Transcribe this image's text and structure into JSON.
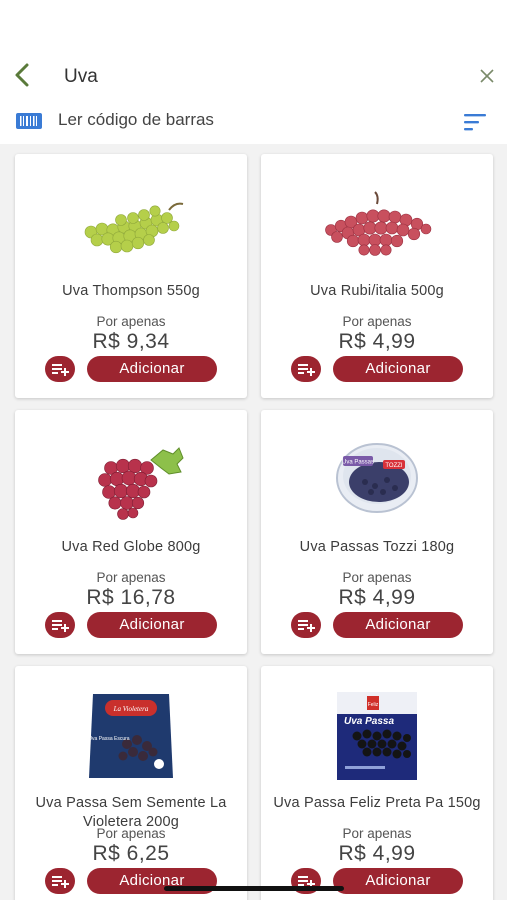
{
  "header": {
    "search_query": "Uva",
    "barcode_label": "Ler código de barras"
  },
  "products": [
    {
      "name": "Uva Thompson 550g",
      "price_prefix": "Por apenas",
      "price": "R$ 9,34",
      "add_label": "Adicionar"
    },
    {
      "name": "Uva Rubi/italia 500g",
      "price_prefix": "Por apenas",
      "price": "R$ 4,99",
      "add_label": "Adicionar"
    },
    {
      "name": "Uva Red Globe 800g",
      "price_prefix": "Por apenas",
      "price": "R$ 16,78",
      "add_label": "Adicionar"
    },
    {
      "name": "Uva Passas Tozzi 180g",
      "price_prefix": "Por apenas",
      "price": "R$ 4,99",
      "add_label": "Adicionar"
    },
    {
      "name": "Uva Passa Sem Semente La Violetera 200g",
      "price_prefix": "Por apenas",
      "price": "R$ 6,25",
      "add_label": "Adicionar"
    },
    {
      "name": "Uva Passa Feliz Preta Pa 150g",
      "price_prefix": "Por apenas",
      "price": "R$ 4,99",
      "add_label": "Adicionar"
    }
  ],
  "package_labels": {
    "tozzi": "Uva Passas",
    "tozzi_brand": "TOZZI",
    "violetera": "La Violetera",
    "violetera_sub": "Uva Passa Escura",
    "feliz": "Uva Passa",
    "feliz_brand": "Feliz"
  },
  "colors": {
    "accent": "#9c2530",
    "barcode_icon": "#3a7bd5",
    "back_icon": "#5a7a3a"
  }
}
